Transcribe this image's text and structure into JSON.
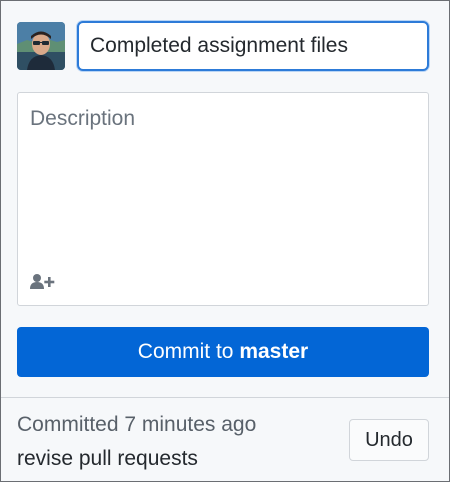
{
  "commit": {
    "summary_value": "Completed assignment files",
    "description_placeholder": "Description",
    "button_prefix": "Commit to ",
    "branch": "master"
  },
  "icons": {
    "avatar": "user-avatar",
    "coauthor": "add-coauthor-icon"
  },
  "last_commit": {
    "status": "Committed 7 minutes ago",
    "message": "revise pull requests",
    "undo_label": "Undo"
  },
  "colors": {
    "accent": "#0366d6",
    "focus_border": "#2d7bd8",
    "panel_bg": "#f6f8fa"
  }
}
